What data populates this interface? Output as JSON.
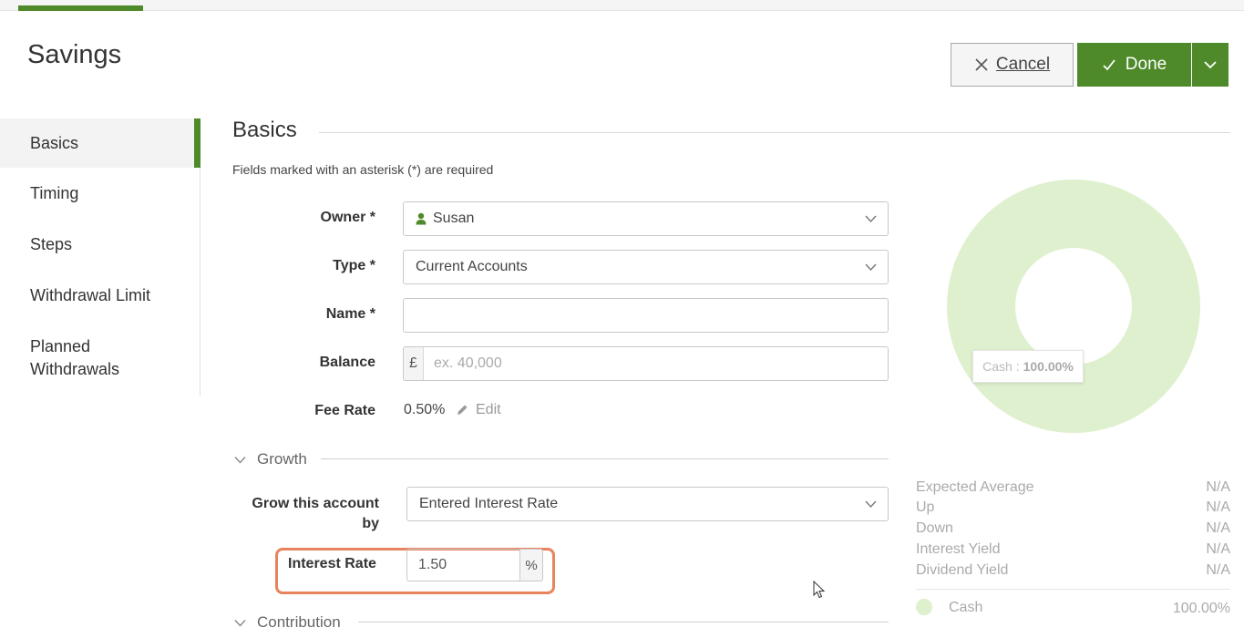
{
  "page": {
    "title": "Savings"
  },
  "actions": {
    "cancel_label": "Cancel",
    "done_label": "Done"
  },
  "sidebar": {
    "items": [
      {
        "label": "Basics",
        "active": true
      },
      {
        "label": "Timing"
      },
      {
        "label": "Steps"
      },
      {
        "label": "Withdrawal Limit"
      },
      {
        "label": "Planned Withdrawals"
      }
    ]
  },
  "basics": {
    "title": "Basics",
    "required_note": "Fields marked with an asterisk (*) are required",
    "owner": {
      "label": "Owner *",
      "value": "Susan"
    },
    "type": {
      "label": "Type *",
      "value": "Current Accounts"
    },
    "name": {
      "label": "Name *",
      "value": ""
    },
    "balance": {
      "label": "Balance",
      "prefix": "£",
      "placeholder": "ex. 40,000"
    },
    "fee_rate": {
      "label": "Fee Rate",
      "value": "0.50%",
      "edit_label": "Edit"
    }
  },
  "growth": {
    "title": "Growth",
    "grow_by": {
      "label": "Grow this account by",
      "value": "Entered Interest Rate"
    },
    "interest_rate": {
      "label": "Interest Rate",
      "value": "1.50",
      "suffix": "%"
    }
  },
  "contribution": {
    "title": "Contribution"
  },
  "allocation": {
    "tooltip": {
      "name": "Cash : ",
      "value": "100.00%"
    },
    "stats": [
      {
        "label": "Expected Average",
        "value": "N/A"
      },
      {
        "label": "Up",
        "value": "N/A"
      },
      {
        "label": "Down",
        "value": "N/A"
      },
      {
        "label": "Interest Yield",
        "value": "N/A"
      },
      {
        "label": "Dividend Yield",
        "value": "N/A"
      }
    ],
    "legend": [
      {
        "name": "Cash",
        "value": "100.00%",
        "color": "#dff0ce"
      }
    ]
  },
  "colors": {
    "accent": "#4e8a2a",
    "highlight": "#e8845d",
    "chart_fill": "#dff0ce"
  },
  "chart_data": {
    "type": "pie",
    "categories": [
      "Cash"
    ],
    "values": [
      100.0
    ]
  }
}
